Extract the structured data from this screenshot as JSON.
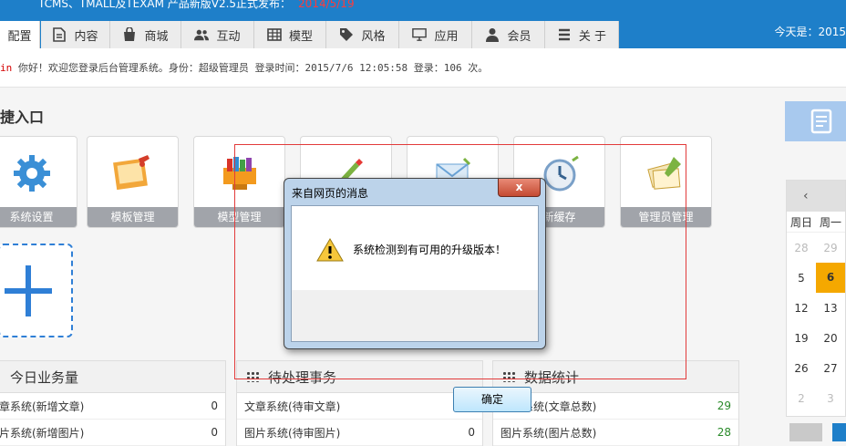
{
  "banner": {
    "announcement": "TCMS、TMALL及TEXAM 产品新版V2.5正式发布：",
    "date": "2014/5/19"
  },
  "nav": {
    "tabs": [
      {
        "label": "配置",
        "icon": "gear-icon",
        "active": true
      },
      {
        "label": "内容",
        "icon": "document-icon"
      },
      {
        "label": "商城",
        "icon": "shopping-bag-icon"
      },
      {
        "label": "互动",
        "icon": "users-icon"
      },
      {
        "label": "模型",
        "icon": "table-icon"
      },
      {
        "label": "风格",
        "icon": "tag-icon"
      },
      {
        "label": "应用",
        "icon": "monitor-icon"
      },
      {
        "label": "会员",
        "icon": "user-icon"
      },
      {
        "label": "关 于",
        "icon": "list-icon"
      }
    ],
    "today_label": "今天是：2015"
  },
  "welcome": {
    "user": "in",
    "text": " 你好！欢迎您登录后台管理系统。身份：超级管理员 登录时间：2015/7/6 12:05:58 登录：106 次。"
  },
  "quick_entry": {
    "title": "捷入口",
    "cards": [
      {
        "label": "系统设置",
        "icon": "gear-icon"
      },
      {
        "label": "模板管理",
        "icon": "template-icon"
      },
      {
        "label": "模型管理",
        "icon": "books-icon"
      },
      {
        "label": "",
        "icon": "edit-icon"
      },
      {
        "label": "",
        "icon": "mail-icon"
      },
      {
        "label": "新缓存",
        "icon": "clock-icon"
      },
      {
        "label": "管理员管理",
        "icon": "admin-icon"
      }
    ],
    "add_label": "+"
  },
  "panels": [
    {
      "title": "今日业务量",
      "rows": [
        {
          "name": "章系统(新增文章)",
          "value": "0"
        },
        {
          "name": "片系统(新增图片)",
          "value": "0"
        }
      ]
    },
    {
      "title": "待处理事务",
      "rows": [
        {
          "name": "文章系统(待审文章)",
          "value": "0"
        },
        {
          "name": "图片系统(待审图片)",
          "value": "0"
        }
      ]
    },
    {
      "title": "数据统计",
      "rows": [
        {
          "name": "文章系统(文章总数)",
          "value": "29"
        },
        {
          "name": "图片系统(图片总数)",
          "value": "28"
        }
      ]
    }
  ],
  "calendar": {
    "prev": "‹",
    "weekdays": [
      "周日",
      "周一"
    ],
    "rows": [
      [
        "28",
        "29"
      ],
      [
        "5",
        "6"
      ],
      [
        "12",
        "13"
      ],
      [
        "19",
        "20"
      ],
      [
        "26",
        "27"
      ],
      [
        "2",
        "3"
      ]
    ],
    "today": "6"
  },
  "dialog": {
    "title": "来自网页的消息",
    "close": "x",
    "message": "系统检测到有可用的升级版本！",
    "ok": "确定",
    "icon": "warning-icon"
  },
  "colors": {
    "nav_blue": "#1e7fc9",
    "date_red": "#ff3b3b",
    "today_orange": "#f5a800",
    "value_green": "#2a8a2a"
  }
}
